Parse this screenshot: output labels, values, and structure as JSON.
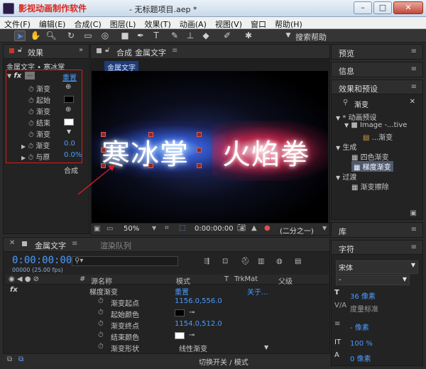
{
  "titlebar": {
    "brand": "影视动画制作软件",
    "document_title": "- 无标题项目.aep *",
    "minimize": "–",
    "maximize": "□",
    "close": "✕"
  },
  "menu": [
    "文件(F)",
    "编辑(E)",
    "合成(C)",
    "图层(L)",
    "效果(T)",
    "动画(A)",
    "视图(V)",
    "窗口",
    "帮助(H)"
  ],
  "toolbar": {
    "icons": [
      "selection-tool",
      "hand-tool",
      "zoom-tool",
      "rotate-tool",
      "camera-tool",
      "pan-behind-tool",
      "rectangle-tool",
      "pen-tool",
      "type-tool",
      "brush-tool",
      "clone-stamp-tool",
      "eraser-tool",
      "roto-brush-tool",
      "puppet-pin-tool"
    ],
    "search_help": "搜索帮助"
  },
  "effect_controls": {
    "tab_label": "效果",
    "layer_path": "金属文字 • 寒冰掌",
    "fx_label": "fx",
    "reset": "重置",
    "rows": [
      {
        "label": "渐变",
        "value": ""
      },
      {
        "label": "起始",
        "value": ""
      },
      {
        "label": "渐变",
        "value": ""
      },
      {
        "label": "结束",
        "value": ""
      },
      {
        "label": "渐变",
        "value": ""
      },
      {
        "label": "渐变",
        "value": "0.0"
      },
      {
        "label": "与原",
        "value": "0.0%"
      }
    ],
    "footer": "合成"
  },
  "composition": {
    "tab_label": "合成",
    "tab_name": "金属文字",
    "viewer_label": "金属文字",
    "text_left": "寒冰掌",
    "text_right": "火焰拳",
    "zoom": "50%",
    "timecode": "0:00:00:00",
    "resolution": "(二分之一)"
  },
  "timeline": {
    "tab_label": "金属文字",
    "render_queue": "渲染队列",
    "timecode": "0:00:00:00",
    "frame_info": "00000 (25.00 fps)",
    "search_placeholder": "",
    "headers": {
      "num": "#",
      "source_name": "源名称",
      "mode": "模式",
      "t": "T",
      "trkmat": "TrkMat",
      "parent": "父级"
    },
    "effect_row": {
      "fx": "fx",
      "name": "梯度渐变",
      "reset": "重置",
      "about": "关于..."
    },
    "params": [
      {
        "name": "渐变起点",
        "value": "1156.0,556.0"
      },
      {
        "name": "起始颜色",
        "value": ""
      },
      {
        "name": "渐变终点",
        "value": "1154.0,512.0"
      },
      {
        "name": "结束颜色",
        "value": ""
      },
      {
        "name": "渐变形状",
        "value": "线性渐变"
      }
    ],
    "footer": "切换开关 / 模式"
  },
  "right_panels": {
    "preview": "预览",
    "info": "信息",
    "effects_presets": "效果和预设",
    "search_value": "渐变",
    "tree": [
      {
        "label": "* 动画预设",
        "level": 0
      },
      {
        "label": "Image -...tive",
        "level": 1
      },
      {
        "label": "...渐变",
        "level": 2
      },
      {
        "label": "生成",
        "level": 0
      },
      {
        "label": "四色渐变",
        "level": 1
      },
      {
        "label": "梯度渐变",
        "level": 1
      },
      {
        "label": "过渡",
        "level": 0
      },
      {
        "label": "渐变擦除",
        "level": 1
      }
    ],
    "library": "库",
    "character": "字符",
    "font": "宋体",
    "font_style": "-",
    "font_size": "36 像素",
    "kerning": "度量标准",
    "leading": "- 像素",
    "scale": "100 %",
    "baseline": "0 像素"
  },
  "colors": {
    "accent_blue": "#4a9bff",
    "annotation_red": "#d02020"
  }
}
